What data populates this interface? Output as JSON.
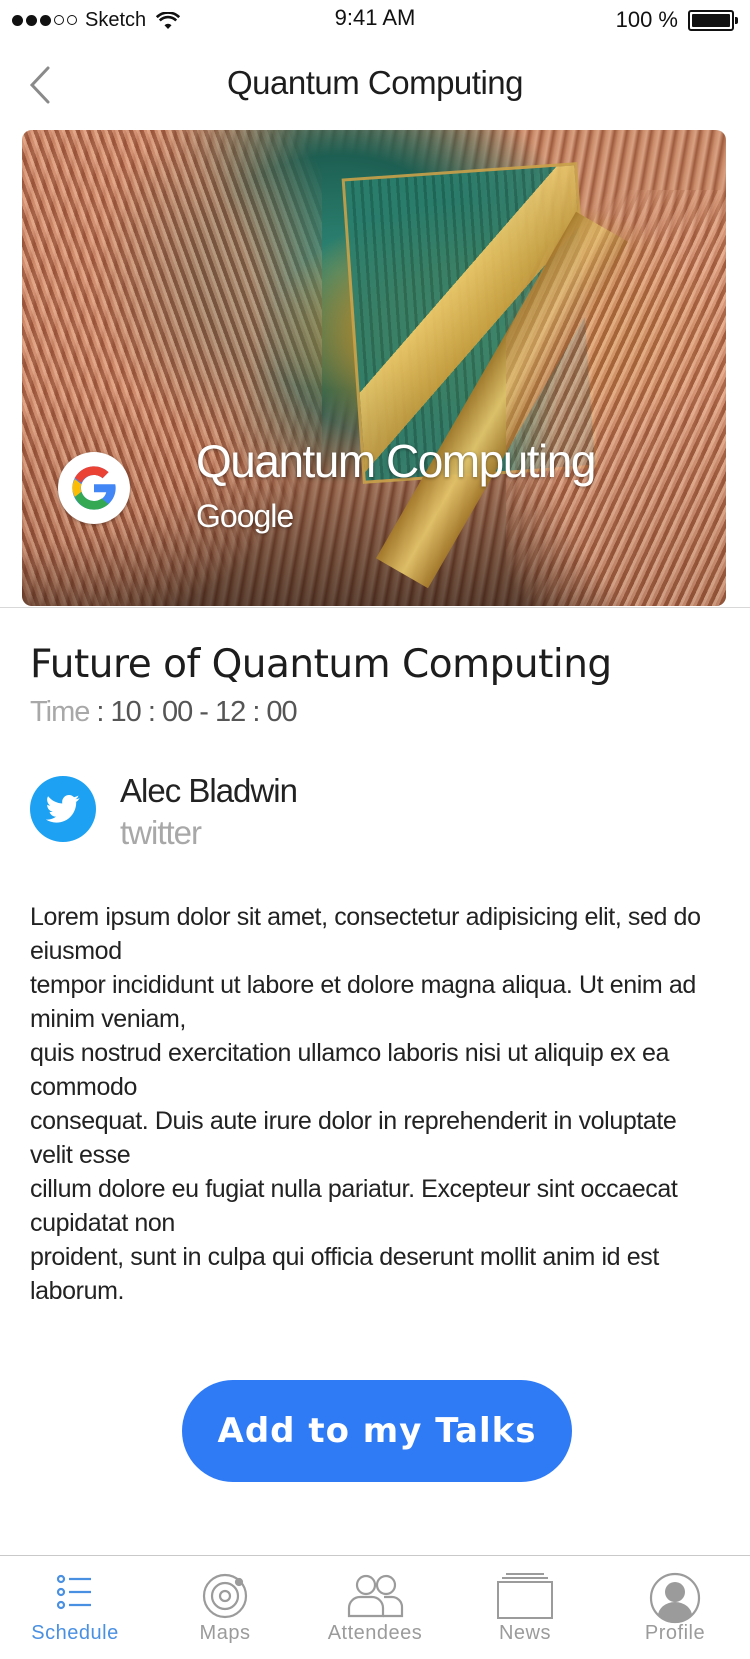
{
  "status_bar": {
    "carrier": "Sketch",
    "time": "9:41 AM",
    "battery": "100 %"
  },
  "nav": {
    "title": "Quantum Computing"
  },
  "hero": {
    "title": "Quantum Computing",
    "subtitle": "Google"
  },
  "talk": {
    "title": "Future of Quantum Computing",
    "time_label": "Time",
    "time_sep": " : ",
    "time_value": "10 : 00 - 12 : 00"
  },
  "speaker": {
    "name": "Alec Bladwin",
    "source": "twitter"
  },
  "description": [
    "Lorem ipsum dolor sit amet, consectetur adipisicing elit, sed do eiusmod",
    "tempor incididunt ut labore et dolore magna aliqua. Ut enim ad minim veniam,",
    "quis nostrud exercitation ullamco laboris nisi ut aliquip ex ea commodo",
    "consequat. Duis aute irure dolor in reprehenderit in voluptate velit esse",
    "cillum dolore eu fugiat nulla pariatur. Excepteur sint occaecat cupidatat non",
    "proident, sunt in culpa qui officia deserunt mollit anim id est laborum."
  ],
  "cta": {
    "label": "Add to my Talks"
  },
  "tabs": [
    {
      "label": "Schedule",
      "icon": "schedule-icon",
      "active": true
    },
    {
      "label": "Maps",
      "icon": "maps-icon",
      "active": false
    },
    {
      "label": "Attendees",
      "icon": "attendees-icon",
      "active": false
    },
    {
      "label": "News",
      "icon": "news-icon",
      "active": false
    },
    {
      "label": "Profile",
      "icon": "profile-icon",
      "active": false
    }
  ],
  "colors": {
    "accent": "#2f7bf6",
    "tab_active": "#4a90e2",
    "tab_inactive": "#9b9b9b",
    "twitter": "#1da1f2"
  }
}
